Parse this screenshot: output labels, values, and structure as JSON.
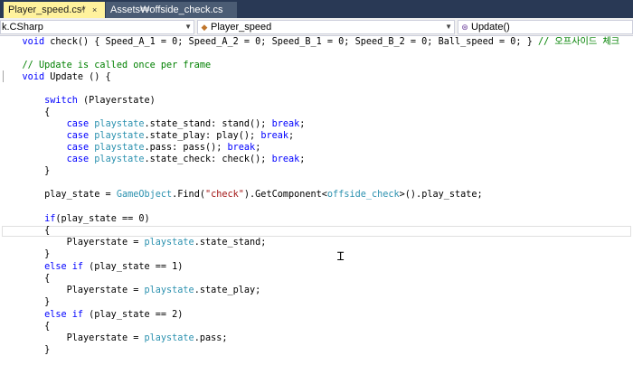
{
  "tabs": [
    {
      "label": "Player_speed.cs*",
      "active": true
    },
    {
      "label": "Assets₩offside_check.cs",
      "active": false
    }
  ],
  "tab_controls": {
    "pin": "⊣",
    "close": "×"
  },
  "nav": {
    "project": "k.CSharp",
    "class": "Player_speed",
    "member": "Update()"
  },
  "colors": {
    "tab_bar": "#293955",
    "active_tab": "#fff29d",
    "keyword": "#0000ff",
    "type": "#2b91af",
    "string": "#a31515",
    "comment": "#008000"
  },
  "code": {
    "l01": {
      "a": "void",
      "b": " check() { Speed_A_1 = 0; Speed_A_2 = 0; Speed_B_1 = 0; Speed_B_2 = 0; Ball_speed = 0; } ",
      "c": "// 오프사이드 체크"
    },
    "l03": {
      "a": "// Update is called once per frame"
    },
    "l04": {
      "a": "void",
      "b": " Update () {"
    },
    "l06": {
      "a": "switch",
      "b": " (Playerstate)"
    },
    "l07": {
      "a": "{"
    },
    "l08": {
      "a": "case",
      "b": " ",
      "c": "playstate",
      "d": ".state_stand: stand(); ",
      "e": "break",
      "f": ";"
    },
    "l09": {
      "a": "case",
      "b": " ",
      "c": "playstate",
      "d": ".state_play: play(); ",
      "e": "break",
      "f": ";"
    },
    "l10": {
      "a": "case",
      "b": " ",
      "c": "playstate",
      "d": ".pass: pass(); ",
      "e": "break",
      "f": ";"
    },
    "l11": {
      "a": "case",
      "b": " ",
      "c": "playstate",
      "d": ".state_check: check(); ",
      "e": "break",
      "f": ";"
    },
    "l12": {
      "a": "}"
    },
    "l14": {
      "a": "play_state = ",
      "b": "GameObject",
      "c": ".Find(",
      "d": "\"check\"",
      "e": ").GetComponent<",
      "f": "offside_check",
      "g": ">().play_state;"
    },
    "l16": {
      "a": "if",
      "b": "(play_state == 0)"
    },
    "l17": {
      "a": "{"
    },
    "l18": {
      "a": "Playerstate = ",
      "b": "playstate",
      "c": ".state_stand;"
    },
    "l19": {
      "a": "}"
    },
    "l20": {
      "a": "else if",
      "b": " (play_state == 1)"
    },
    "l21": {
      "a": "{"
    },
    "l22": {
      "a": "Playerstate = ",
      "b": "playstate",
      "c": ".state_play;"
    },
    "l23": {
      "a": "}"
    },
    "l24": {
      "a": "else if",
      "b": " (play_state == 2)"
    },
    "l25": {
      "a": "{"
    },
    "l26": {
      "a": "Playerstate = ",
      "b": "playstate",
      "c": ".pass;"
    },
    "l27": {
      "a": "}"
    }
  }
}
